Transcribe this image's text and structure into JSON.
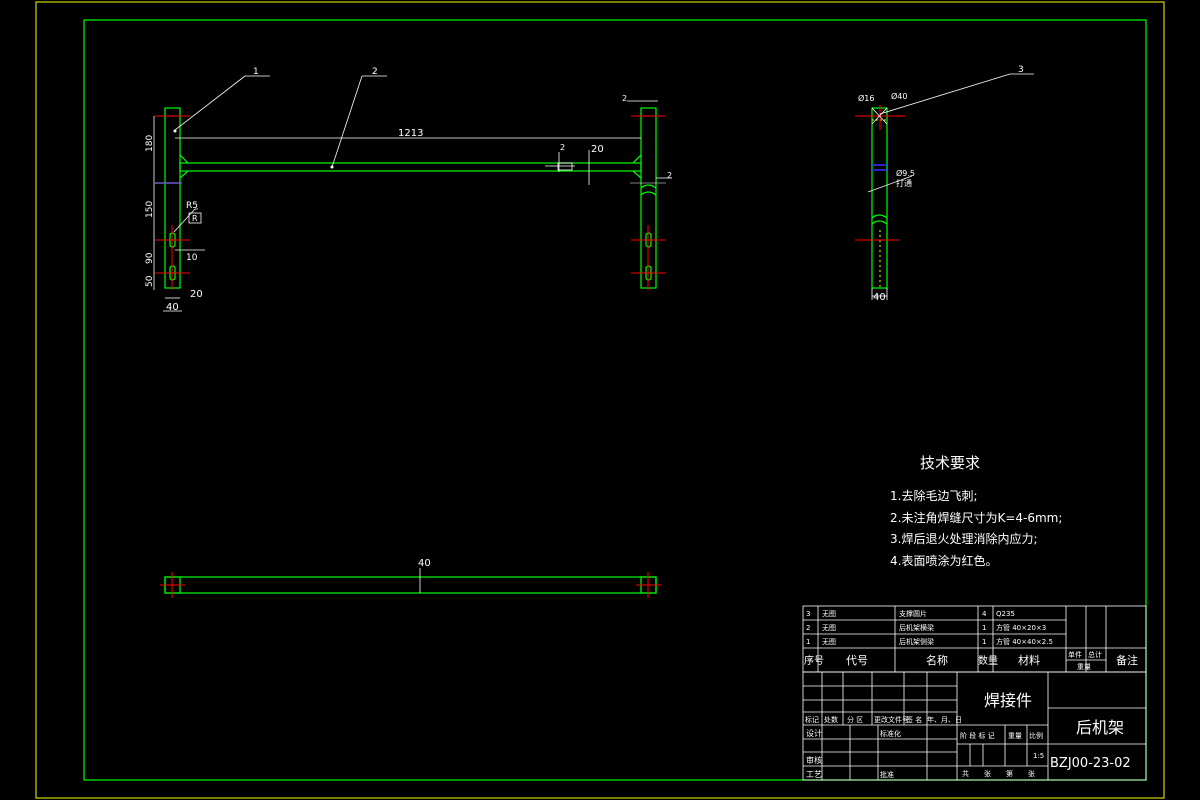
{
  "colors": {
    "background": "#000000",
    "outer_frame": "#ffff00",
    "inner_frame": "#00ff00",
    "part_lines": "#00ff00",
    "center_lines": "#ff0000",
    "annotation": "#ffffff"
  },
  "drawing": {
    "balloons": [
      "1",
      "2",
      "3"
    ],
    "front_view": {
      "overall_length": "1213",
      "dim_gap_top": "2",
      "dim_20_right": "20",
      "dim_2_small": "2",
      "dim_2_side": "2",
      "dim_180": "180",
      "dim_150": "150",
      "dim_90": "90",
      "dim_50": "50",
      "dim_R5": "R5",
      "dim_R": "R",
      "dim_10": "10",
      "dim_20_bottom": "20",
      "dim_40": "40"
    },
    "side_view": {
      "dia16": "Ø16",
      "dia40": "Ø40",
      "dia95": "Ø9.5",
      "drill_note": "打通",
      "width40": "40"
    },
    "top_view": {
      "width40": "40"
    }
  },
  "requirements": {
    "title": "技术要求",
    "items": [
      "1.去除毛边飞刺;",
      "2.未注角焊缝尺寸为K=4-6mm;",
      "3.焊后退火处理消除内应力;",
      "4.表面喷涂为红色。"
    ]
  },
  "bom": {
    "rows": [
      {
        "no": "3",
        "code": "无图",
        "name": "支撑圆片",
        "qty": "4",
        "material": "Q235"
      },
      {
        "no": "2",
        "code": "无图",
        "name": "后机架横梁",
        "qty": "1",
        "material": "方管 40×20×3"
      },
      {
        "no": "1",
        "code": "无图",
        "name": "后机架侧梁",
        "qty": "1",
        "material": "方管 40×40×2.5"
      }
    ],
    "header": {
      "no": "序号",
      "code": "代号",
      "name": "名称",
      "qty": "数量",
      "material": "材料",
      "weight_single": "单件",
      "weight_total": "总计",
      "weight": "重量",
      "remark": "备注"
    }
  },
  "title_block": {
    "assembly_type": "焊接件",
    "part_name": "后机架",
    "drawing_no": "BZJ00-23-02",
    "scale": "1:5",
    "rev_labels": [
      "标记",
      "处数",
      "分 区",
      "更改文件号",
      "签 名",
      "年、月、日"
    ],
    "role_labels": [
      "设计",
      "审核",
      "工艺"
    ],
    "std_label": "标准化",
    "approve_label": "批准",
    "stage_labels": [
      "阶 段 标 记",
      "重量",
      "比例"
    ],
    "sheet_labels": [
      "共",
      "张",
      "第",
      "张"
    ]
  }
}
